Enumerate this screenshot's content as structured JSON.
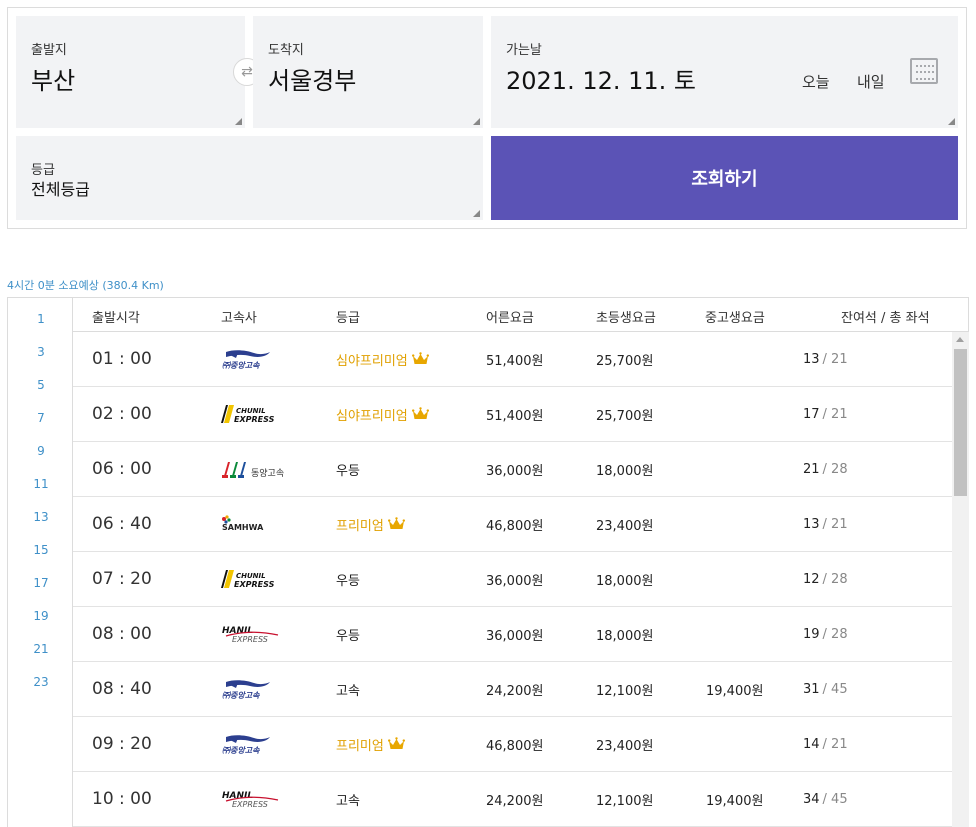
{
  "search": {
    "departure_label": "출발지",
    "departure_value": "부산",
    "arrival_label": "도착지",
    "arrival_value": "서울경부",
    "date_label": "가는날",
    "date_value": "2021. 12. 11. 토",
    "today_label": "오늘",
    "tomorrow_label": "내일",
    "grade_label": "등급",
    "grade_value": "전체등급",
    "search_button": "조회하기",
    "swap_icon": "⇄"
  },
  "summary": "4시간 0분 소요예상 (380.4 Km)",
  "hours": [
    "1",
    "3",
    "5",
    "7",
    "9",
    "11",
    "13",
    "15",
    "17",
    "19",
    "21",
    "23"
  ],
  "table": {
    "headers": {
      "time": "출발시각",
      "company": "고속사",
      "grade": "등급",
      "adult": "어른요금",
      "child": "초등생요금",
      "teen": "중고생요금",
      "seats": "잔여석 / 총 좌석"
    },
    "rows": [
      {
        "time": "01 : 00",
        "company": "jungang",
        "grade": "심야프리미엄",
        "premium": true,
        "adult": "51,400원",
        "child": "25,700원",
        "teen": "",
        "remaining": "13",
        "total": "/ 21"
      },
      {
        "time": "02 : 00",
        "company": "chunil",
        "grade": "심야프리미엄",
        "premium": true,
        "adult": "51,400원",
        "child": "25,700원",
        "teen": "",
        "remaining": "17",
        "total": "/ 21"
      },
      {
        "time": "06 : 00",
        "company": "dongyang",
        "grade": "우등",
        "premium": false,
        "adult": "36,000원",
        "child": "18,000원",
        "teen": "",
        "remaining": "21",
        "total": "/ 28"
      },
      {
        "time": "06 : 40",
        "company": "samhwa",
        "grade": "프리미엄",
        "premium": true,
        "adult": "46,800원",
        "child": "23,400원",
        "teen": "",
        "remaining": "13",
        "total": "/ 21"
      },
      {
        "time": "07 : 20",
        "company": "chunil",
        "grade": "우등",
        "premium": false,
        "adult": "36,000원",
        "child": "18,000원",
        "teen": "",
        "remaining": "12",
        "total": "/ 28"
      },
      {
        "time": "08 : 00",
        "company": "hanil",
        "grade": "우등",
        "premium": false,
        "adult": "36,000원",
        "child": "18,000원",
        "teen": "",
        "remaining": "19",
        "total": "/ 28"
      },
      {
        "time": "08 : 40",
        "company": "jungang",
        "grade": "고속",
        "premium": false,
        "adult": "24,200원",
        "child": "12,100원",
        "teen": "19,400원",
        "remaining": "31",
        "total": "/ 45"
      },
      {
        "time": "09 : 20",
        "company": "jungang",
        "grade": "프리미엄",
        "premium": true,
        "adult": "46,800원",
        "child": "23,400원",
        "teen": "",
        "remaining": "14",
        "total": "/ 21"
      },
      {
        "time": "10 : 00",
        "company": "hanil",
        "grade": "고속",
        "premium": false,
        "adult": "24,200원",
        "child": "12,100원",
        "teen": "19,400원",
        "remaining": "34",
        "total": "/ 45"
      }
    ]
  },
  "logos": {
    "jungang": {
      "text": "㈜중앙고속"
    },
    "chunil": {
      "line1": "CHUNIL",
      "line2": "EXPRESS"
    },
    "dongyang": {
      "text": "동양고속"
    },
    "samhwa": {
      "text": "SAMHWA"
    },
    "hanil": {
      "line1": "HANIL",
      "line2": "EXPRESS"
    }
  },
  "colors": {
    "accent": "#5b53b6",
    "premium": "#e0a000",
    "link": "#3f90c8"
  },
  "icons": {
    "crown": "crown-icon",
    "calendar": "calendar-icon",
    "swap": "swap-icon"
  }
}
